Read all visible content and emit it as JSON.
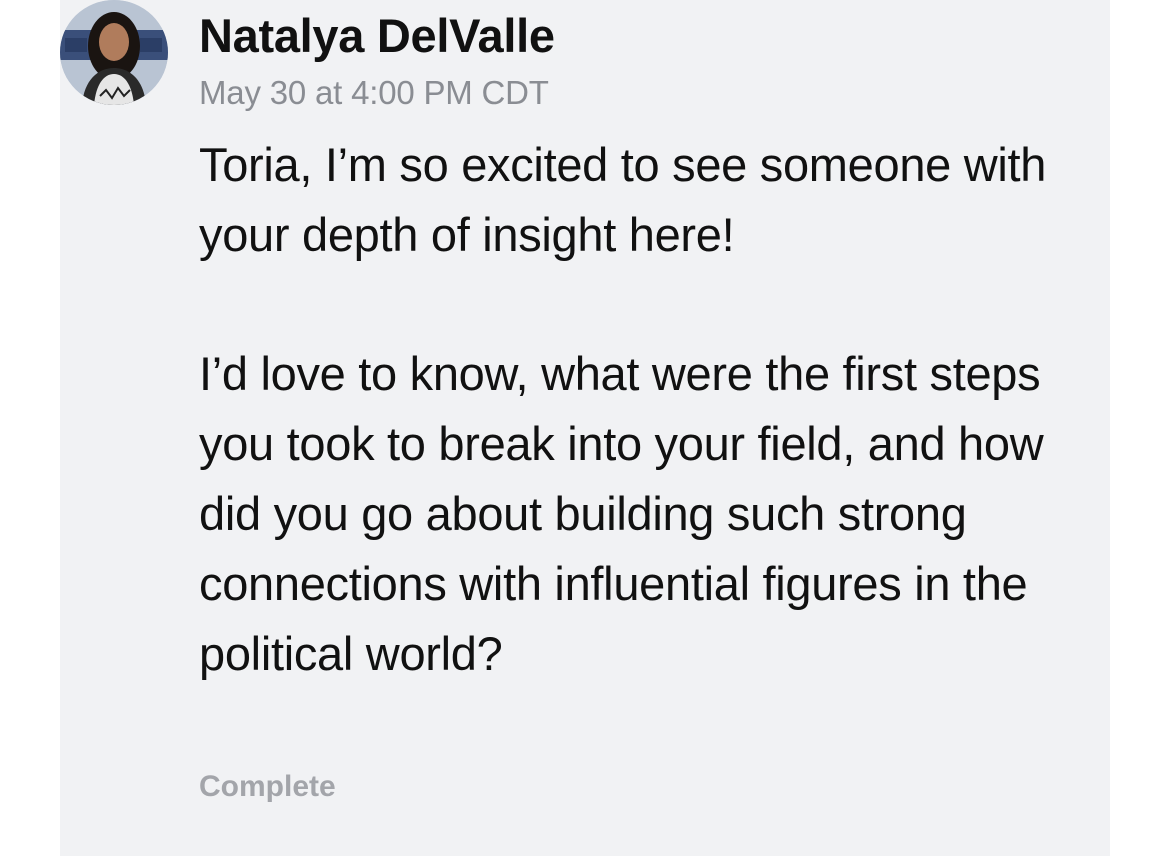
{
  "comment": {
    "author": "Natalya DelValle",
    "timestamp": "May 30 at 4:00 PM CDT",
    "paragraphs": [
      "Toria, I’m so excited to see someone with your depth of insight here!",
      "I’d love to know, what were the first steps you took to break into your field, and how did you go about building such strong connections with influential figures in the political world?"
    ],
    "status": "Complete"
  },
  "colors": {
    "card_background": "#f1f2f4",
    "text_primary": "#111111",
    "text_muted": "#8a8d93",
    "status_text": "#a3a5aa"
  },
  "icons": {
    "avatar": "user-avatar-photo"
  }
}
